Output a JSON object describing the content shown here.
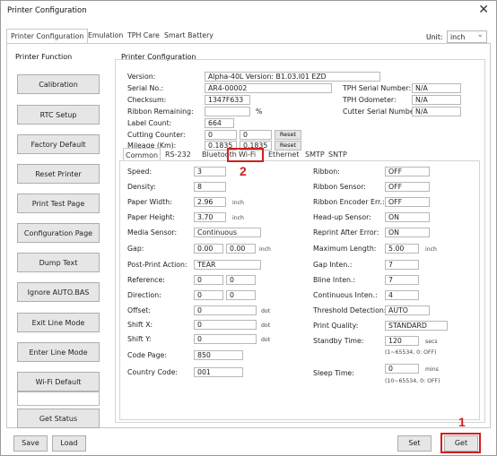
{
  "window": {
    "title": "Printer Configuration",
    "close": "✕"
  },
  "tabs": [
    "Printer Configuration",
    "Emulation",
    "TPH Care",
    "Smart Battery"
  ],
  "unit": {
    "label": "Unit:",
    "value": "inch"
  },
  "left": {
    "title": "Printer Function",
    "buttons": [
      "Calibration",
      "RTC Setup",
      "Factory Default",
      "Reset Printer",
      "Print Test Page",
      "Configuration Page",
      "Dump Text",
      "Ignore AUTO.BAS",
      "Exit Line Mode",
      "Enter Line Mode",
      "Wi-Fi Default"
    ],
    "status_button": "Get Status"
  },
  "config": {
    "title": "Printer Configuration",
    "version_label": "Version:",
    "version": "Alpha-40L Version: B1.03.I01 EZD",
    "serial_label": "Serial No.:",
    "serial": "AR4-00002",
    "checksum_label": "Checksum:",
    "checksum": "1347F633",
    "ribbon_label": "Ribbon Remaining:",
    "ribbon_unit": "%",
    "label_count_label": "Label Count:",
    "label_count": "664",
    "cutting_label": "Cutting Counter:",
    "cutting_1": "0",
    "cutting_2": "0",
    "mileage_label": "Mileage (Km):",
    "mileage_1": "0.1835",
    "mileage_2": "0.1835",
    "reset": "Reset",
    "tph_serial_label": "TPH Serial Number:",
    "tph_serial": "N/A",
    "tph_odo_label": "TPH Odometer:",
    "tph_odo": "N/A",
    "cutter_serial_label": "Cutter Serial Number:",
    "cutter_serial": "N/A"
  },
  "subtabs": [
    "Common",
    "RS-232",
    "Bluetooth",
    "Wi-Fi",
    "Ethernet",
    "SMTP",
    "SNTP"
  ],
  "common": {
    "speed_label": "Speed:",
    "speed": "3",
    "density_label": "Density:",
    "density": "8",
    "paper_width_label": "Paper Width:",
    "paper_width": "2.96",
    "paper_width_unit": "inch",
    "paper_height_label": "Paper Height:",
    "paper_height": "3.70",
    "paper_height_unit": "inch",
    "media_sensor_label": "Media Sensor:",
    "media_sensor": "Continuous",
    "gap_label": "Gap:",
    "gap_1": "0.00",
    "gap_2": "0.00",
    "gap_unit": "inch",
    "post_print_label": "Post-Print Action:",
    "post_print": "TEAR",
    "reference_label": "Reference:",
    "reference_1": "0",
    "reference_2": "0",
    "direction_label": "Direction:",
    "direction_1": "0",
    "direction_2": "0",
    "offset_label": "Offset:",
    "offset": "0",
    "offset_unit": "dot",
    "shiftx_label": "Shift X:",
    "shiftx": "0",
    "shiftx_unit": "dot",
    "shifty_label": "Shift Y:",
    "shifty": "0",
    "shifty_unit": "dot",
    "codepage_label": "Code Page:",
    "codepage": "850",
    "country_label": "Country Code:",
    "country": "001",
    "ribbon_label": "Ribbon:",
    "ribbon": "OFF",
    "ribbon_sensor_label": "Ribbon Sensor:",
    "ribbon_sensor": "OFF",
    "ribbon_encoder_label": "Ribbon Encoder Err.:",
    "ribbon_encoder": "OFF",
    "headup_label": "Head-up Sensor:",
    "headup": "ON",
    "reprint_label": "Reprint After Error:",
    "reprint": "ON",
    "max_length_label": "Maximum Length:",
    "max_length": "5.00",
    "max_length_unit": "inch",
    "gap_inten_label": "Gap Inten.:",
    "gap_inten": "7",
    "bline_label": "Bline Inten.:",
    "bline": "7",
    "continuous_label": "Continuous Inten.:",
    "continuous": "4",
    "threshold_label": "Threshold Detection:",
    "threshold": "AUTO",
    "quality_label": "Print Quality:",
    "quality": "STANDARD",
    "standby_label": "Standby Time:",
    "standby": "120",
    "standby_unit": "secs",
    "standby_range": "(1~65534, 0: OFF)",
    "sleep_label": "Sleep Time:",
    "sleep": "0",
    "sleep_unit": "mins",
    "sleep_range": "(10~65534, 0: OFF)"
  },
  "bottom": {
    "save": "Save",
    "load": "Load",
    "set": "Set",
    "get": "Get"
  },
  "annotations": {
    "marker1": "1",
    "marker2": "2",
    "color": "#d21f1f"
  }
}
